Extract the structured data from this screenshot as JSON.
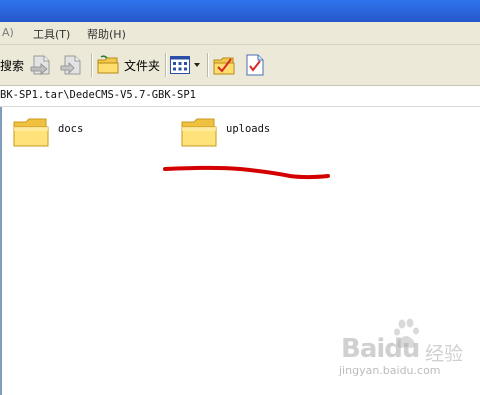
{
  "menu": {
    "item_edit_partial": "A)",
    "item_tools": "工具(T)",
    "item_help": "帮助(H)"
  },
  "toolbar": {
    "search_label": "搜索",
    "folders_label": "文件夹"
  },
  "address": {
    "path": "BK-SP1.tar\\DedeCMS-V5.7-GBK-SP1"
  },
  "folders": [
    {
      "name": "docs",
      "icon": "folder-icon"
    },
    {
      "name": "uploads",
      "icon": "folder-icon"
    }
  ],
  "annotation": {
    "color": "#d40000",
    "meaning": "underline under uploads"
  },
  "watermark": {
    "brand": "Bai",
    "brand_suffix": "du",
    "cn": "经验",
    "url": "jingyan.baidu.com"
  },
  "colors": {
    "titlebar": "#2a62d8",
    "chrome": "#ece9d8",
    "annotation": "#d40000"
  }
}
